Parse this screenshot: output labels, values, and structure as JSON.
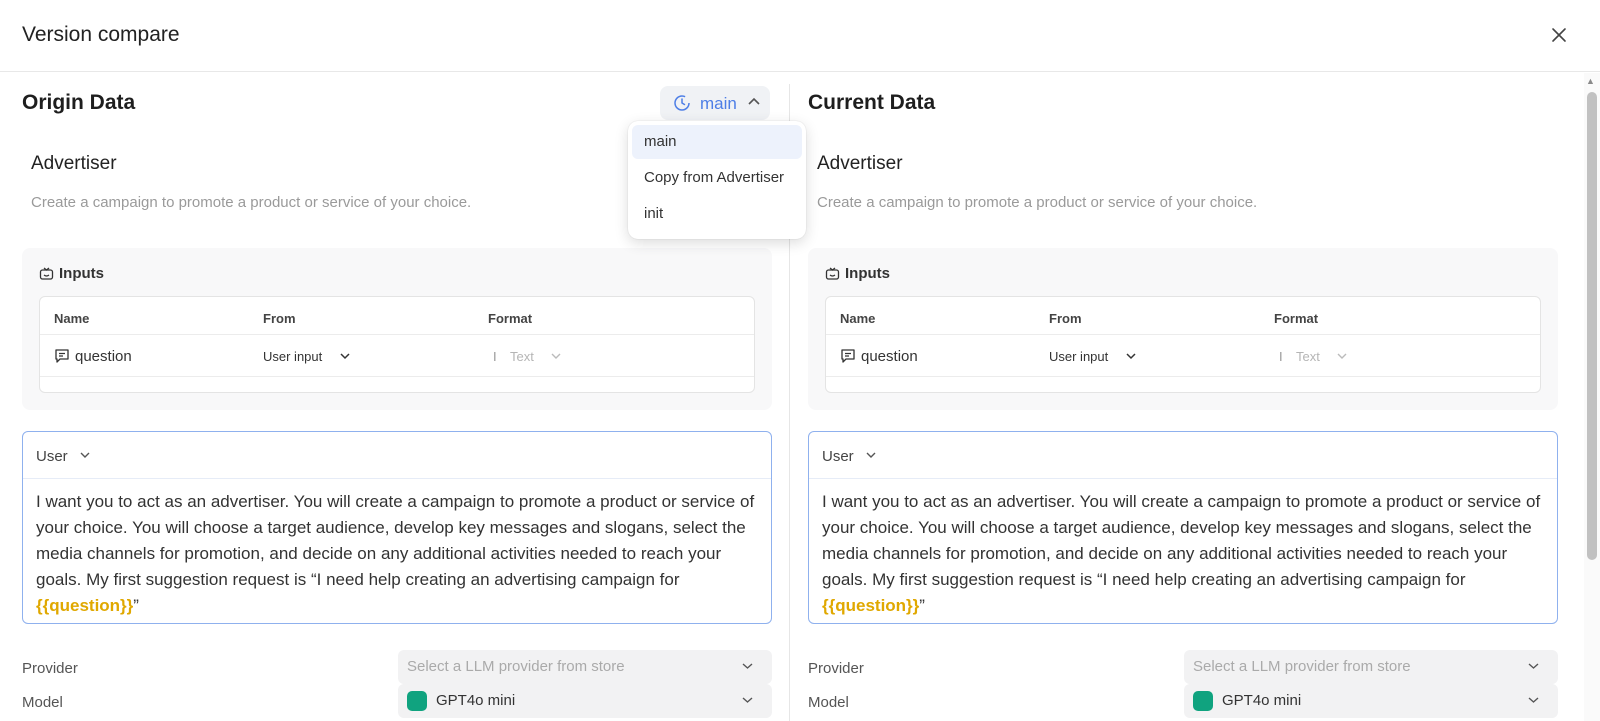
{
  "header": {
    "title": "Version compare"
  },
  "version_select": {
    "current": "main",
    "options": [
      "main",
      "Copy from Advertiser",
      "init"
    ]
  },
  "left": {
    "title": "Origin Data",
    "agent": {
      "name": "Advertiser",
      "description": "Create a campaign to promote a product or service of your choice."
    },
    "inputs": {
      "heading": "Inputs",
      "columns": [
        "Name",
        "From",
        "Format"
      ],
      "row": {
        "name": "question",
        "from": "User input",
        "format": "Text"
      }
    },
    "prompt": {
      "role": "User",
      "text": "I want you to act as an advertiser. You will create a campaign to promote a product or service of your choice. You will choose a target audience, develop key messages and slogans, select the media channels for promotion, and decide on any additional activities needed to reach your goals. My first suggestion request is “I need help creating an advertising campaign for ",
      "variable": "{{question}}",
      "suffix": "”"
    },
    "provider": {
      "label": "Provider",
      "placeholder": "Select a LLM provider from store"
    },
    "model": {
      "label": "Model",
      "value": "GPT4o mini"
    }
  },
  "right": {
    "title": "Current Data",
    "agent": {
      "name": "Advertiser",
      "description": "Create a campaign to promote a product or service of your choice."
    },
    "inputs": {
      "heading": "Inputs",
      "columns": [
        "Name",
        "From",
        "Format"
      ],
      "row": {
        "name": "question",
        "from": "User input",
        "format": "Text"
      }
    },
    "prompt": {
      "role": "User",
      "text": "I want you to act as an advertiser. You will create a campaign to promote a product or service of your choice. You will choose a target audience, develop key messages and slogans, select the media channels for promotion, and decide on any additional activities needed to reach your goals. My first suggestion request is “I need help creating an advertising campaign for ",
      "variable": "{{question}}",
      "suffix": "”"
    },
    "provider": {
      "label": "Provider",
      "placeholder": "Select a LLM provider from store"
    },
    "model": {
      "label": "Model",
      "value": "GPT4o mini"
    }
  },
  "colors": {
    "accent": "#4d7ee6",
    "variable": "#e0a800",
    "prompt_border": "#8fb1ee",
    "gpt_icon": "#10a37f"
  }
}
